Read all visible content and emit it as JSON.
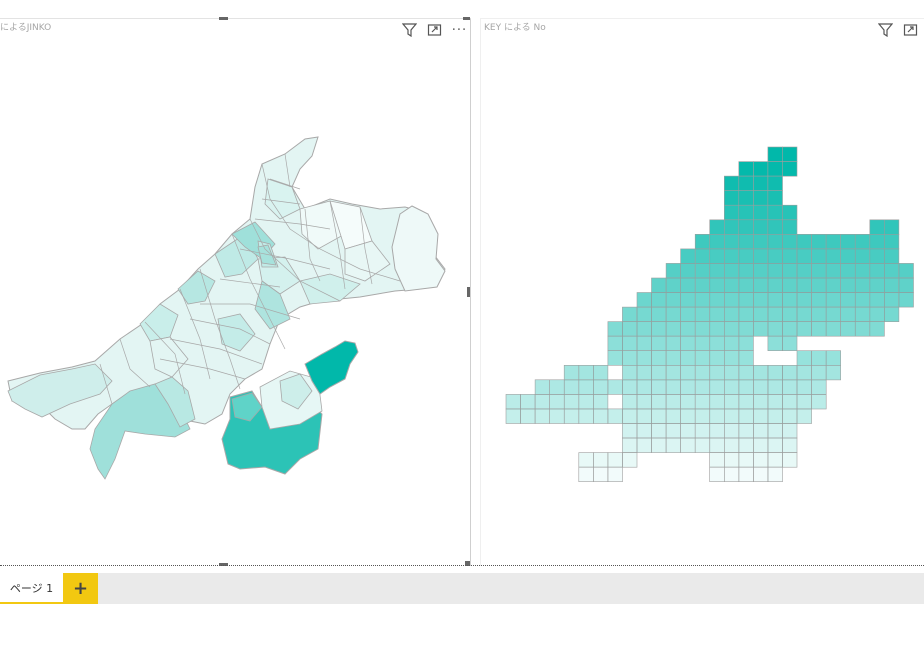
{
  "report": {
    "visuals": [
      {
        "title": "によるJINKO",
        "type": "filled-map"
      },
      {
        "title": "KEY による No",
        "type": "grid-map"
      }
    ],
    "header_icons": [
      "filter-icon",
      "focus-mode-icon",
      "more-options-icon"
    ],
    "pages": [
      {
        "label": "ページ 1",
        "active": true
      }
    ],
    "add_page_label": "+"
  },
  "colors": {
    "accent": "#01B8AA",
    "tab_accent": "#F2C811",
    "grid_stroke": "#9E9E9E",
    "region_stroke": "#A8A8A8"
  }
}
